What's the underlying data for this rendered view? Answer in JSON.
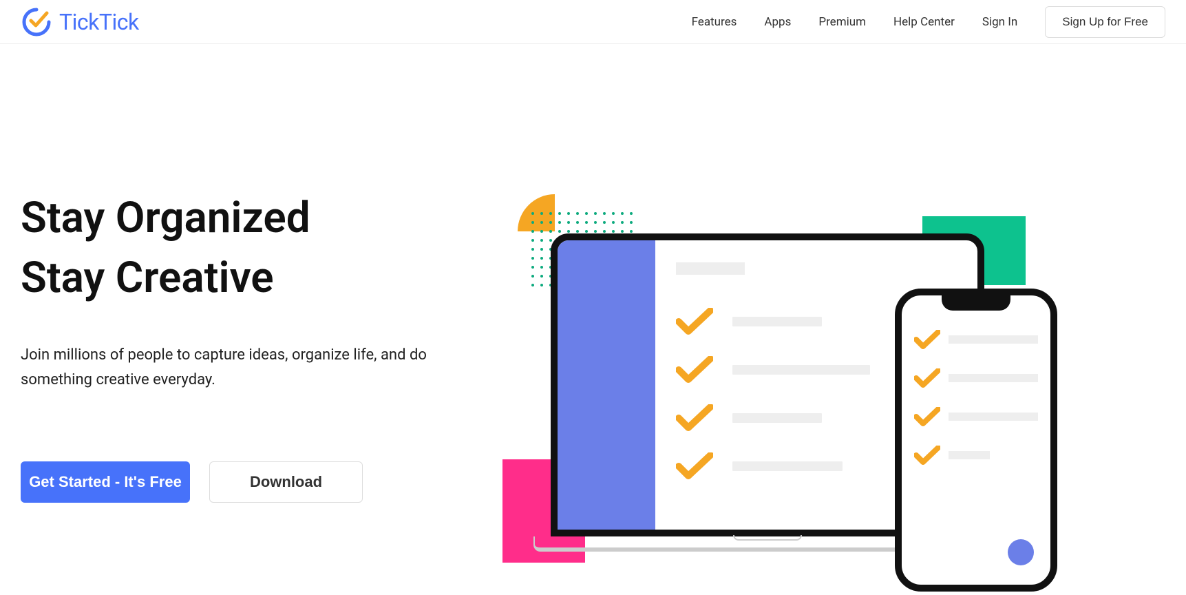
{
  "brand": {
    "name": "TickTick"
  },
  "nav": {
    "items": [
      {
        "label": "Features"
      },
      {
        "label": "Apps"
      },
      {
        "label": "Premium"
      },
      {
        "label": "Help Center"
      },
      {
        "label": "Sign In"
      }
    ],
    "signup": "Sign Up for Free"
  },
  "hero": {
    "title_line1": "Stay Organized",
    "title_line2": "Stay Creative",
    "subtitle": "Join millions of people to capture ideas, organize life, and do something creative everyday.",
    "cta_primary": "Get Started - It's Free",
    "cta_secondary": "Download"
  },
  "colors": {
    "brand_blue": "#4772FA",
    "accent_orange": "#F5A623",
    "accent_green": "#0DC28E",
    "accent_pink": "#FF2D8A",
    "sidebar_purple": "#6B7FE8"
  }
}
